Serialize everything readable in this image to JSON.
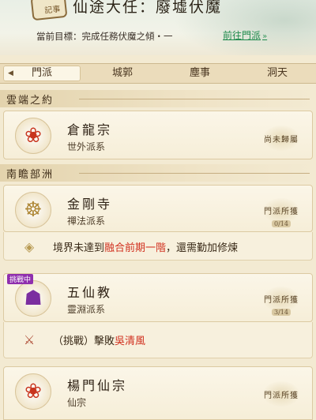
{
  "quest": {
    "icon_label": "記事",
    "title": "仙途大任：廢墟伏魔",
    "goal": "當前目標：完成任務伏魔之傾・一",
    "link": "前往門派",
    "link_arrow": "»"
  },
  "tabs": [
    "門派",
    "城郭",
    "塵事",
    "洞天"
  ],
  "regions": {
    "r1": "雲端之約",
    "r2": "南瞻部洲"
  },
  "sects": [
    {
      "name": "倉龍宗",
      "type": "世外派系",
      "badge": "尚未歸屬",
      "emblem": "fire-lotus-icon"
    },
    {
      "name": "金剛寺",
      "type": "禪法派系",
      "badge": "門派所獲",
      "progress": "0/14",
      "emblem": "lotus-buddha-icon"
    },
    {
      "name": "五仙教",
      "type": "靈淵派系",
      "badge": "門派所獲",
      "progress": "3/14",
      "emblem": "demon-mask-icon",
      "tag": "挑戰中"
    },
    {
      "name": "楊門仙宗",
      "type": "仙宗",
      "badge": "門派所獲",
      "emblem": "fire-lotus-icon"
    }
  ],
  "requirements": {
    "jingang": {
      "pre": "境界未達到",
      "hl": "融合前期一階",
      "post": "，還需勤加修煉"
    },
    "wuxian": {
      "pre": "（挑戰）擊敗",
      "hl": "吳清風"
    }
  },
  "colors": {
    "link": "#1f8a4c",
    "highlight": "#d1301f",
    "accent": "#8f2fae"
  }
}
